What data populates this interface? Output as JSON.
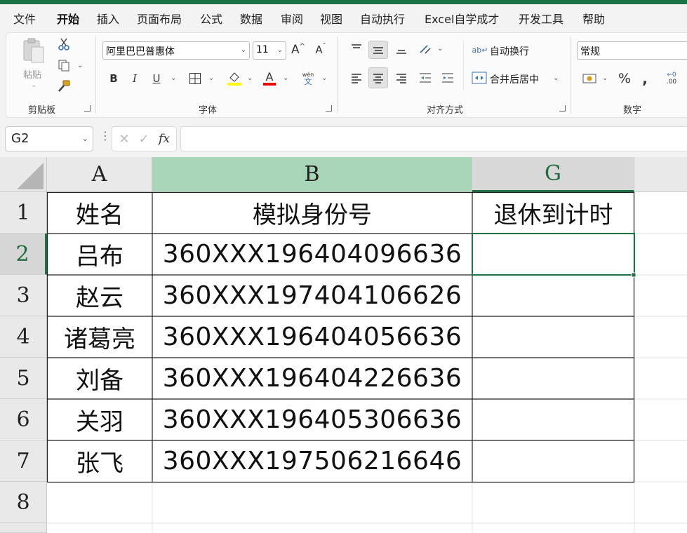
{
  "menu": {
    "tabs": [
      {
        "label": "文件"
      },
      {
        "label": "开始"
      },
      {
        "label": "插入"
      },
      {
        "label": "页面布局"
      },
      {
        "label": "公式"
      },
      {
        "label": "数据"
      },
      {
        "label": "审阅"
      },
      {
        "label": "视图"
      },
      {
        "label": "自动执行"
      },
      {
        "label": "Excel自学成才"
      },
      {
        "label": "开发工具"
      },
      {
        "label": "帮助"
      }
    ],
    "active_tab": "开始"
  },
  "ribbon": {
    "clipboard": {
      "paste_label": "粘贴",
      "group_label": "剪贴板"
    },
    "font": {
      "font_name": "阿里巴巴普惠体",
      "font_size": "11",
      "bold": "B",
      "italic": "I",
      "underline": "U",
      "wen_top": "wén",
      "wen_bottom": "文",
      "group_label": "字体",
      "highlight_color": "#ffff00",
      "font_color": "#ff0000"
    },
    "align": {
      "wrap_label": "自动换行",
      "merge_label": "合并后居中",
      "group_label": "对齐方式"
    },
    "number": {
      "format": "常规",
      "group_label": "数字"
    }
  },
  "formula_bar": {
    "cell_ref": "G2",
    "formula": ""
  },
  "sheet": {
    "columns": [
      "A",
      "B",
      "G"
    ],
    "selected_column": "B",
    "active_cell": "G2",
    "rows": [
      "1",
      "2",
      "3",
      "4",
      "5",
      "6",
      "7",
      "8"
    ],
    "header": {
      "A": "姓名",
      "B": "模拟身份号",
      "G": "退休到计时"
    },
    "data": [
      {
        "name": "吕布",
        "id": "360XXX196404096636",
        "g": ""
      },
      {
        "name": "赵云",
        "id": "360XXX197404106626",
        "g": ""
      },
      {
        "name": "诸葛亮",
        "id": "360XXX196404056636",
        "g": ""
      },
      {
        "name": "刘备",
        "id": "360XXX196404226636",
        "g": ""
      },
      {
        "name": "关羽",
        "id": "360XXX196405306636",
        "g": ""
      },
      {
        "name": "张飞",
        "id": "360XXX197506216646",
        "g": ""
      }
    ],
    "colors": {
      "selected_header": "#a9d5b9",
      "active_border": "#1e7145"
    }
  }
}
